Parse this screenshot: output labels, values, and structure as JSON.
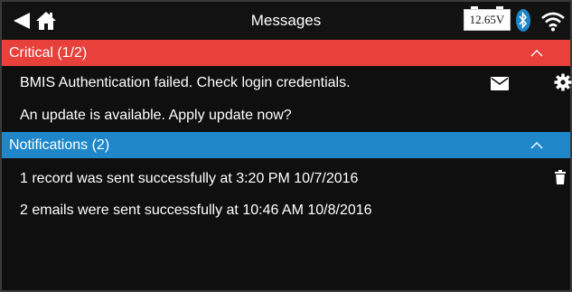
{
  "header": {
    "title": "Messages",
    "battery_voltage": "12.65V",
    "icons": [
      "back-icon",
      "home-icon",
      "battery-icon",
      "bluetooth-icon",
      "wifi-icon"
    ]
  },
  "critical": {
    "label": "Critical (1/2)",
    "color": "#e8403b",
    "items": [
      {
        "text": "BMIS Authentication failed. Check login credentials."
      },
      {
        "text": "An update is available. Apply update now?"
      }
    ]
  },
  "notifications": {
    "label": "Notifications (2)",
    "color": "#1f87c9",
    "items": [
      {
        "text": "1 record was sent successfully at 3:20 PM 10/7/2016"
      },
      {
        "text": "2 emails were sent successfully at 10:46 AM 10/8/2016"
      }
    ]
  }
}
